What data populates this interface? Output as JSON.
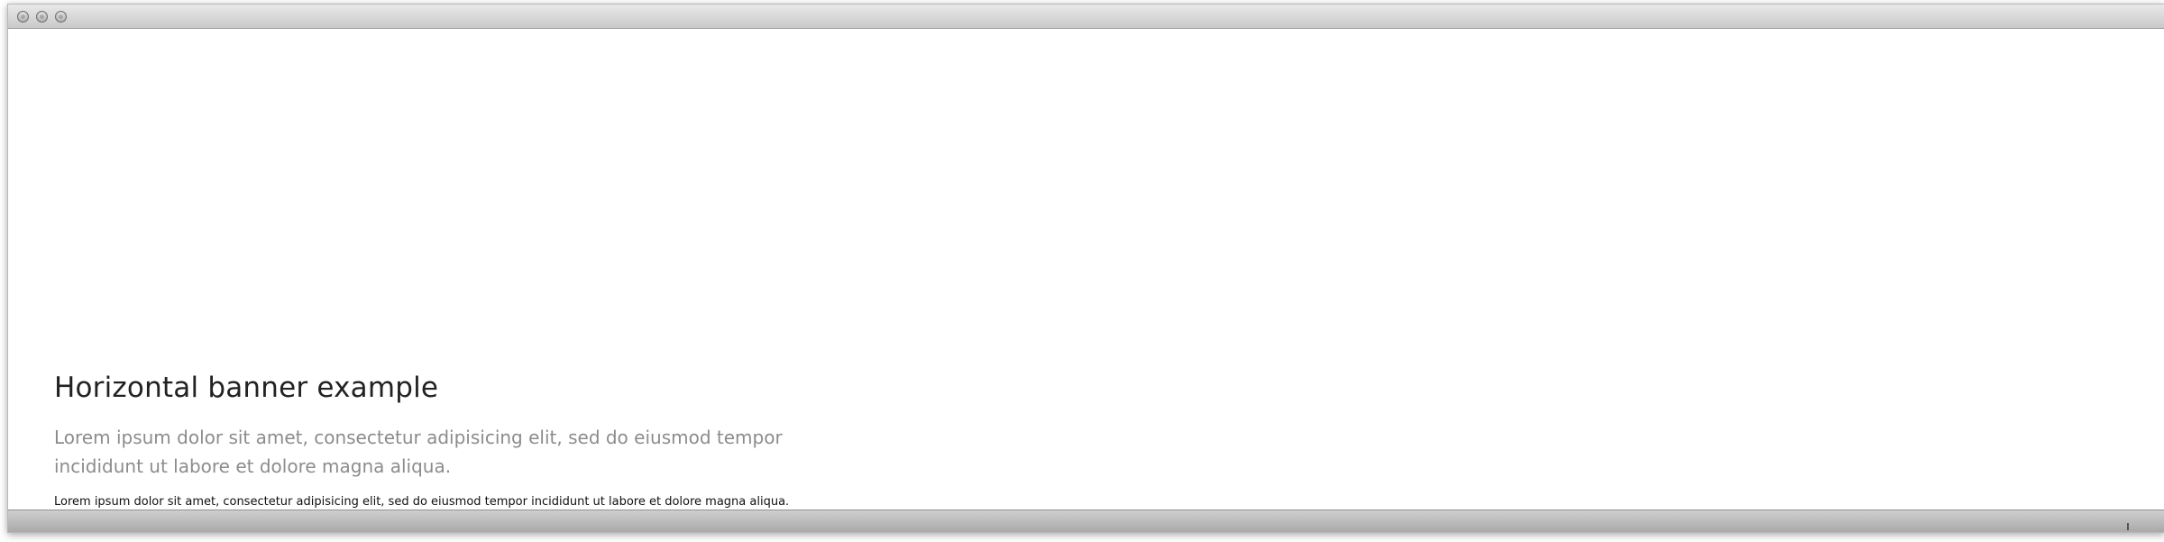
{
  "window": {
    "controls": [
      "close",
      "minimize",
      "zoom"
    ]
  },
  "page": {
    "heading": "Horizontal banner example",
    "lead": "Lorem ipsum dolor sit amet, consectetur adipisicing elit, sed do eiusmod tempor incididunt ut labore et dolore magna aliqua.",
    "body": "Lorem ipsum dolor sit amet, consectetur adipisicing elit, sed do eiusmod tempor incididunt ut labore et dolore magna aliqua."
  },
  "colors": {
    "heading": "#222222",
    "lead": "#8c8c8c",
    "body": "#111111",
    "titlebar": "#d6d6d6"
  }
}
